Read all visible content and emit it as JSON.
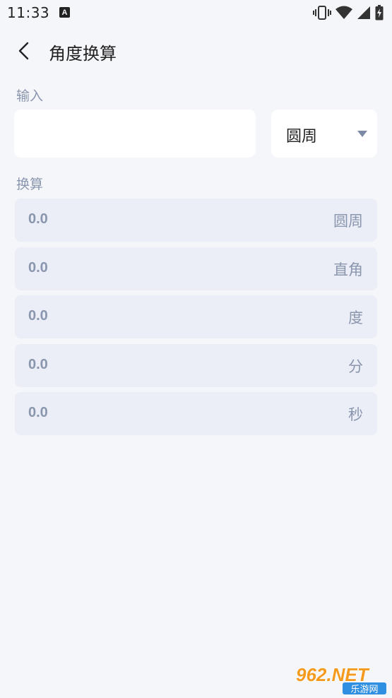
{
  "status_bar": {
    "time": "11:33",
    "notification_letter": "A",
    "icons": [
      "vibrate-icon",
      "wifi-icon",
      "signal-icon",
      "battery-charging-icon"
    ]
  },
  "header": {
    "title": "角度换算",
    "back_icon": "chevron-left-icon"
  },
  "input_section": {
    "label": "输入",
    "value": "",
    "placeholder": "",
    "unit_selected": "圆周"
  },
  "conversion_section": {
    "label": "换算",
    "rows": [
      {
        "value": "0.0",
        "unit": "圆周"
      },
      {
        "value": "0.0",
        "unit": "直角"
      },
      {
        "value": "0.0",
        "unit": "度"
      },
      {
        "value": "0.0",
        "unit": "分"
      },
      {
        "value": "0.0",
        "unit": "秒"
      }
    ]
  },
  "watermark": {
    "main": "962.NET",
    "sub": "乐游网"
  },
  "colors": {
    "background": "#f5f6fa",
    "card": "#ffffff",
    "row": "#ebeef7",
    "muted_text": "#8a96ad",
    "primary_text": "#222222",
    "watermark_orange": "#f39a1f",
    "watermark_blue": "#2f8fe0"
  }
}
